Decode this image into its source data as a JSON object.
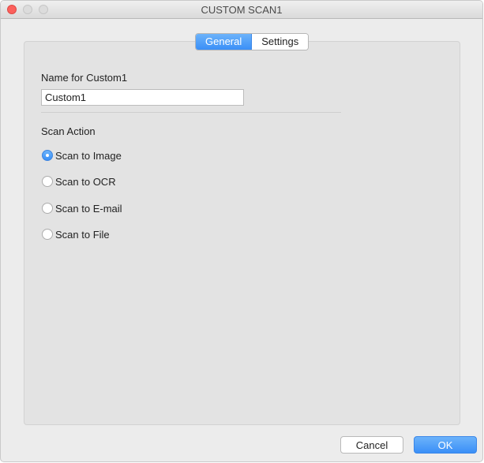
{
  "window": {
    "title": "CUSTOM SCAN1"
  },
  "tabs": [
    {
      "label": "General",
      "active": true
    },
    {
      "label": "Settings",
      "active": false
    }
  ],
  "general": {
    "name_label": "Name for Custom1",
    "name_value": "Custom1",
    "scan_action_label": "Scan Action",
    "scan_actions": [
      {
        "label": "Scan to Image",
        "selected": true
      },
      {
        "label": "Scan to OCR",
        "selected": false
      },
      {
        "label": "Scan to E-mail",
        "selected": false
      },
      {
        "label": "Scan to File",
        "selected": false
      }
    ]
  },
  "buttons": {
    "cancel": "Cancel",
    "ok": "OK"
  },
  "colors": {
    "accent": "#3a8ff7",
    "close": "#fc605c"
  }
}
